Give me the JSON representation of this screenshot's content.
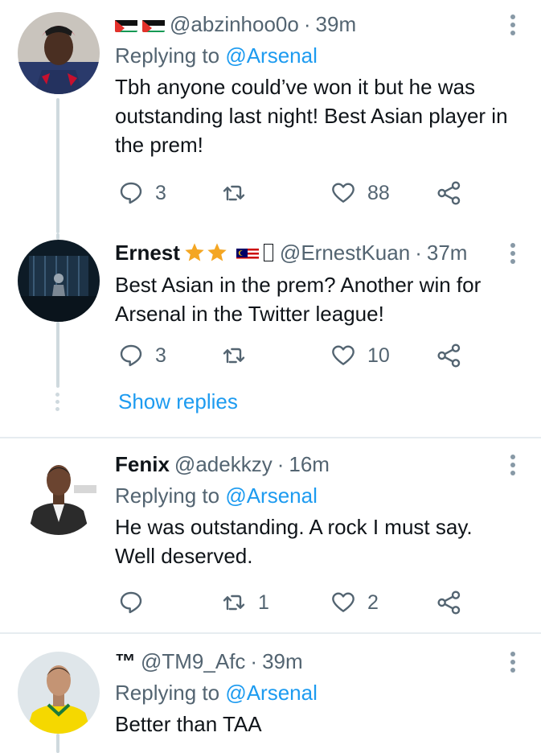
{
  "replying_prefix": "Replying to",
  "tweets": [
    {
      "name": "",
      "handle": "@abzinhoo0o",
      "time": "39m",
      "replying_to": "@Arsenal",
      "text": "Tbh anyone could’ve won it but he was outstanding last night! Best Asian player in the prem!",
      "replies": "3",
      "retweets": "",
      "likes": "88"
    },
    {
      "name": "Ernest",
      "handle": "@ErnestKuan",
      "time": "37m",
      "text": "Best Asian in the prem? Another win for Arsenal in the Twitter league!",
      "replies": "3",
      "retweets": "",
      "likes": "10"
    },
    {
      "name": "Fenix",
      "handle": "@adekkzy",
      "time": "16m",
      "replying_to": "@Arsenal",
      "text": "He was outstanding. A rock I must say. Well deserved.",
      "replies": "",
      "retweets": "1",
      "likes": "2"
    },
    {
      "name": "™",
      "handle": "@TM9_Afc",
      "time": "39m",
      "replying_to": "@Arsenal",
      "text": "Better than TAA"
    }
  ],
  "show_replies_label": "Show replies",
  "separator": "·",
  "icons": [
    "reply-icon",
    "retweet-icon",
    "like-icon",
    "share-icon",
    "more-icon",
    "star-icon",
    "flag-icon"
  ],
  "colors": {
    "accent": "#1d9bf0",
    "secondary_text": "#536471",
    "thread_line": "#cfd9de"
  }
}
